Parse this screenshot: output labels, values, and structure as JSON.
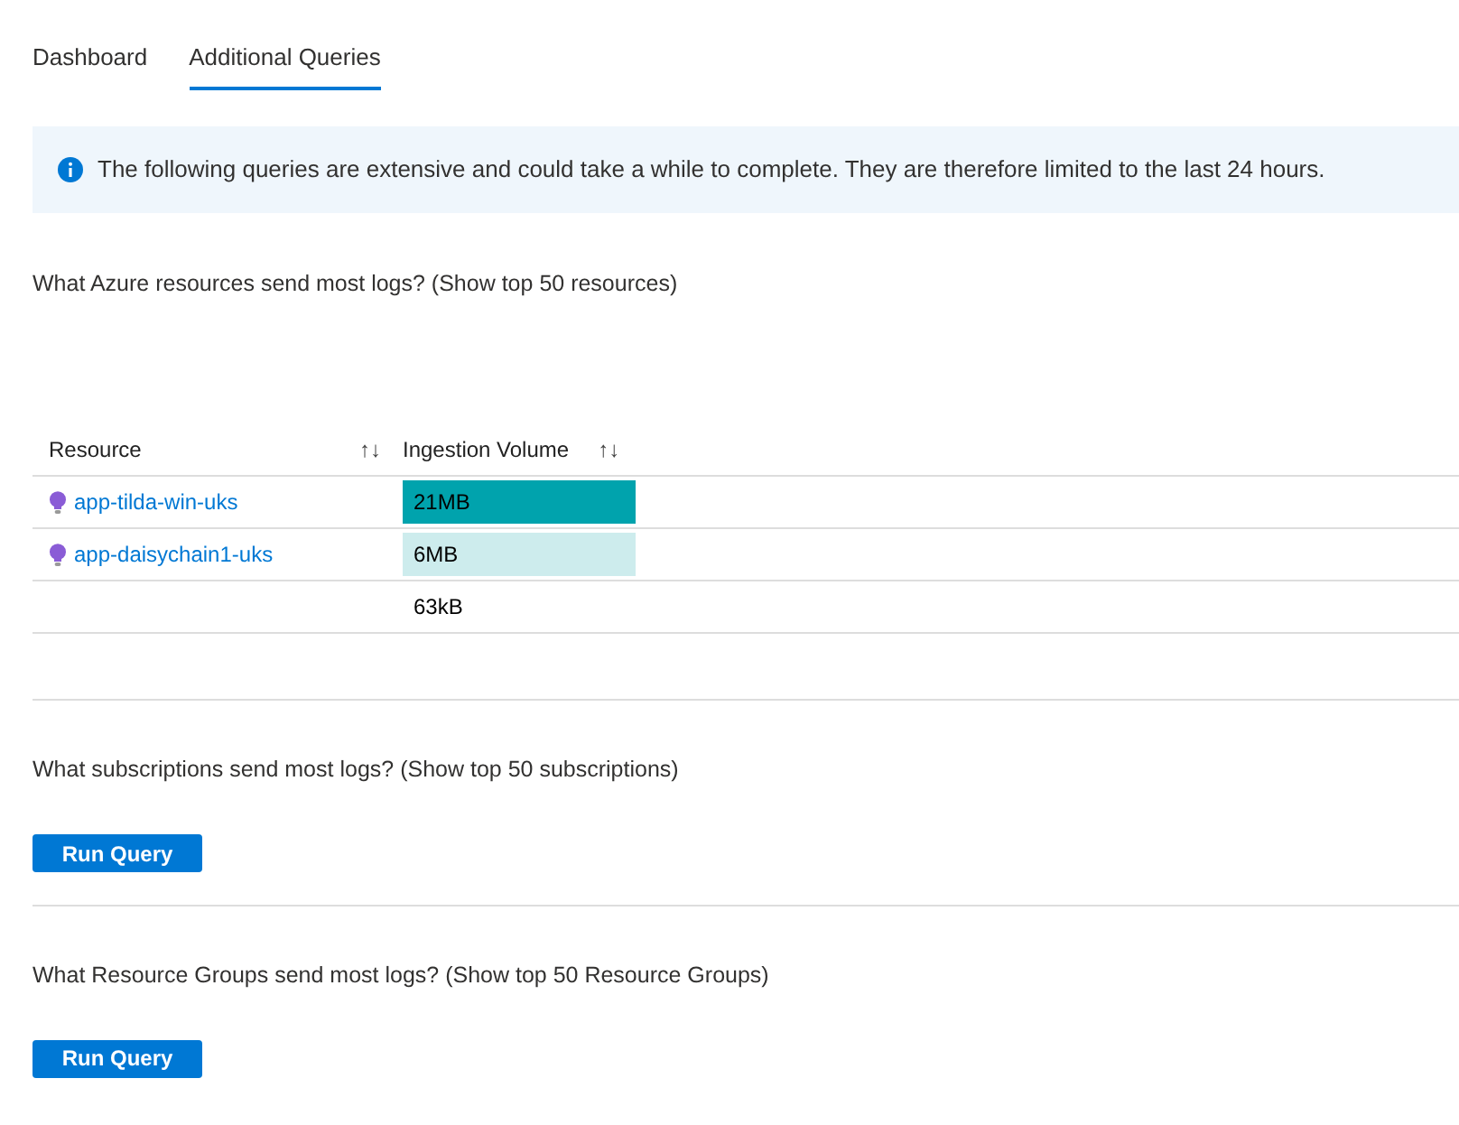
{
  "tabs": [
    {
      "label": "Dashboard",
      "selected": false
    },
    {
      "label": "Additional Queries",
      "selected": true
    }
  ],
  "info": "The following queries are extensive and could take a while to complete. They are therefore limited to the last 24 hours.",
  "queries": [
    {
      "question": "What Azure resources send most logs? (Show top 50 resources)",
      "table": {
        "columns": [
          {
            "label": "Resource",
            "sort": "↑↓"
          },
          {
            "label": "Ingestion Volume",
            "sort": "↑↓"
          }
        ],
        "rows": [
          {
            "resource": "app-tilda-win-uks",
            "volume": "21MB",
            "color": "#00a3ad"
          },
          {
            "resource": "app-daisychain1-uks",
            "volume": "6MB",
            "color": "#cdeced"
          },
          {
            "volume": "63kB"
          }
        ]
      }
    },
    {
      "question": "What subscriptions send most logs? (Show top 50 subscriptions)",
      "button": "Run Query"
    },
    {
      "question": "What Resource Groups send most logs? (Show top 50 Resource Groups)",
      "button": "Run Query"
    }
  ]
}
